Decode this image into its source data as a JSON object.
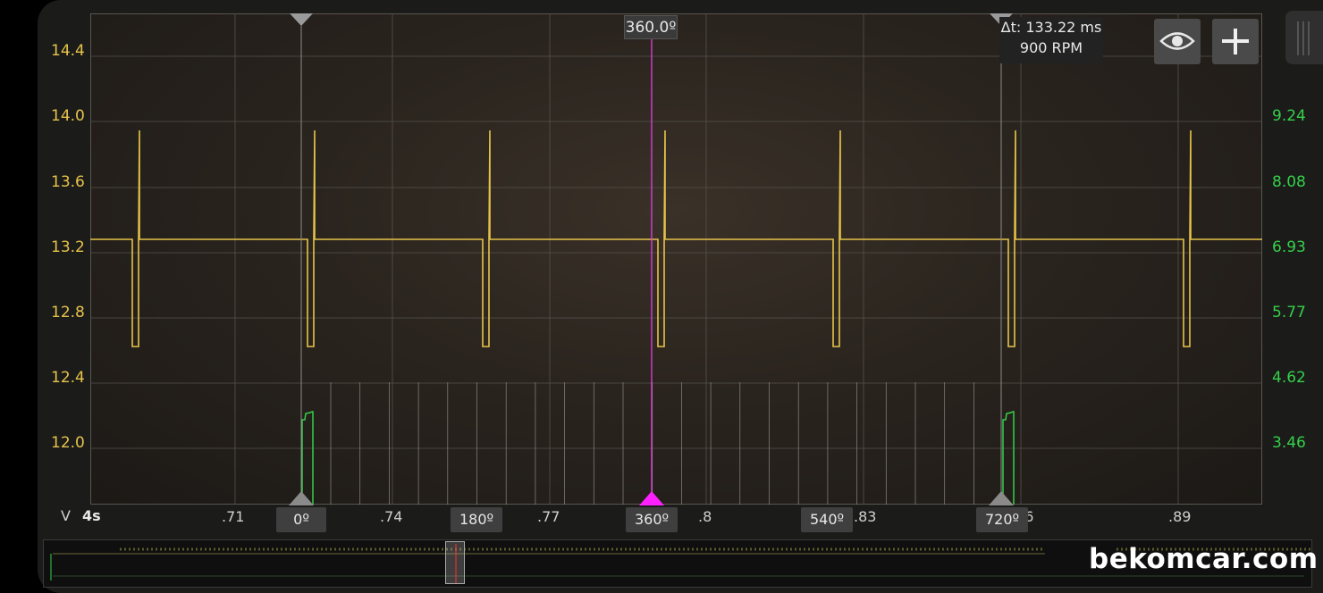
{
  "y_axis_left": {
    "labels": [
      "14.4",
      "14.0",
      "13.6",
      "13.2",
      "12.8",
      "12.4",
      "12.0"
    ],
    "color": "#e6c34a"
  },
  "y_axis_right": {
    "labels": [
      "9.24",
      "8.08",
      "6.93",
      "5.77",
      "4.62",
      "3.46"
    ],
    "color": "#35d04a"
  },
  "x_axis": {
    "unit_label": "V",
    "timebase": "4s",
    "labels": [
      ".71",
      ".74",
      ".77",
      ".8",
      ".83",
      ".86",
      ".89"
    ]
  },
  "cursor": {
    "label": "360.0º",
    "color": "#e040e0"
  },
  "measurement": {
    "delta_t": "Δt: 133.22 ms",
    "rpm": "900 RPM"
  },
  "degree_markers": [
    "0º",
    "180º",
    "360º",
    "540º",
    "720º"
  ],
  "toolbar": {
    "eye_icon": "eye-icon",
    "add_icon": "plus-icon"
  },
  "watermark": "bekomcar.com",
  "colors": {
    "trace_primary": "#e6c34a",
    "trace_secondary": "#35d04a",
    "cursor": "#e040e0",
    "grid": "#55524c"
  }
}
